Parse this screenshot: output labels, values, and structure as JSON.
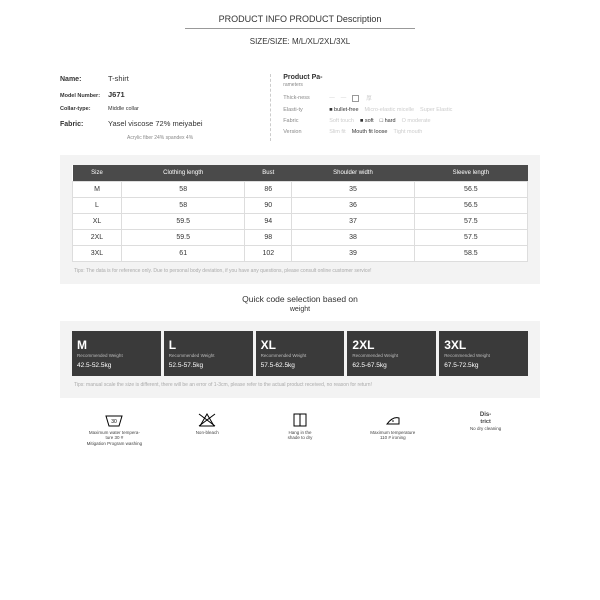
{
  "header": {
    "title": "PRODUCT INFO PRODUCT Description",
    "size_line": "SIZE/SIZE: M/L/XL/2XL/3XL"
  },
  "info_left": {
    "name_label": "Name:",
    "name_value": "T-shirt",
    "model_label": "Model Number:",
    "model_value": "J671",
    "collar_label": "Collar-type:",
    "collar_value": "Middle collar",
    "fabric_label": "Fabric:",
    "fabric_value": "Yasel viscose 72% meiyabei",
    "fabric_note": "Acrylic fiber 24% spandex 4%"
  },
  "info_right": {
    "param_title": "Product Pa-",
    "param_sub": "rameters",
    "row1_label": "Thick-ness",
    "row1_opts": [
      "",
      "",
      "",
      "厚"
    ],
    "row2_label": "Elasti-ty",
    "row2_opts": [
      "bullet-free",
      "Micro-elastic micelle",
      "Super Elastic"
    ],
    "row3_label": "Fabric",
    "row3_opts": [
      "Soft touch",
      "soft",
      "hard",
      "O moderate"
    ],
    "row4_label": "Version",
    "row4_opts": [
      "Slim fit",
      "Mouth fit loose",
      "Tight mouth"
    ]
  },
  "chart_data": {
    "type": "table",
    "headers": [
      "Size",
      "Clothing length",
      "Bust",
      "Shoulder width",
      "Sleeve length"
    ],
    "rows": [
      [
        "M",
        "58",
        "86",
        "35",
        "56.5"
      ],
      [
        "L",
        "58",
        "90",
        "36",
        "56.5"
      ],
      [
        "XL",
        "59.5",
        "94",
        "37",
        "57.5"
      ],
      [
        "2XL",
        "59.5",
        "98",
        "38",
        "57.5"
      ],
      [
        "3XL",
        "61",
        "102",
        "39",
        "58.5"
      ]
    ],
    "tips": "Tips: The data is for reference only. Due to personal body deviation, if you have any questions, please consult online customer service!"
  },
  "quick": {
    "title": "Quick code selection based on",
    "sub": "weight",
    "boxes": [
      {
        "size": "M",
        "label": "Recommended Weight",
        "range": "42.5-52.5kg"
      },
      {
        "size": "L",
        "label": "Recommended Weight",
        "range": "52.5-57.5kg"
      },
      {
        "size": "XL",
        "label": "Recommended Weight",
        "range": "57.5-62.5kg"
      },
      {
        "size": "2XL",
        "label": "Recommended Weight",
        "range": "62.5-67.5kg"
      },
      {
        "size": "3XL",
        "label": "Recommended Weight",
        "range": "67.5-72.5kg"
      }
    ],
    "tips": "Tips: manual scale the size is different, there will be an error of 1-3cm, please refer to the actual product received, no reason for return!"
  },
  "care": [
    {
      "label1": "Maximum water tempera-",
      "label2": "ture 30 #",
      "label3": "Mitigation Program washing"
    },
    {
      "label1": "Non-bleach"
    },
    {
      "label1": "Hang in the",
      "label2": "shade to dry"
    },
    {
      "label1": "Maximum temperature",
      "label2": "110 # ironing"
    },
    {
      "title": "Dis-",
      "sub": "trict",
      "label1": "No dry cleaning"
    }
  ]
}
